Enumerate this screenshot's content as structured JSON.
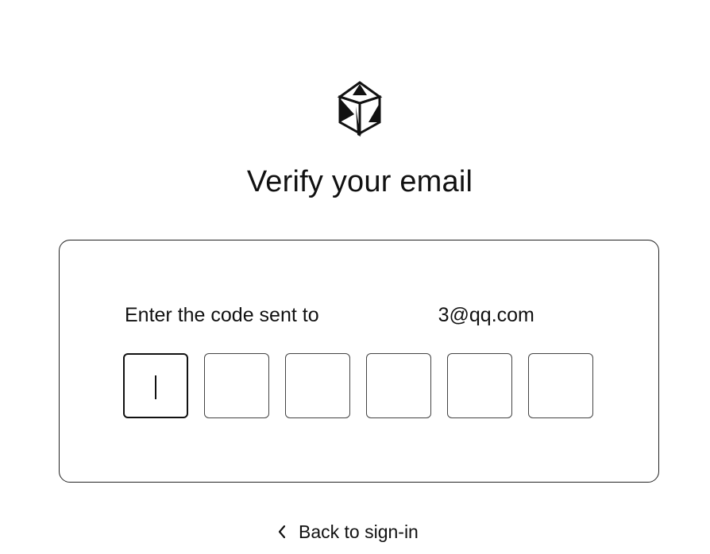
{
  "logo": {
    "icon": "cube-logo-icon"
  },
  "heading": "Verify your email",
  "card": {
    "prompt_prefix": "Enter the code sent to",
    "email_visible": "3@qq.com",
    "otp": {
      "length": 6,
      "active_index": 0,
      "values": [
        "",
        "",
        "",
        "",
        "",
        ""
      ]
    }
  },
  "back_link": {
    "label": "Back to sign-in",
    "icon": "chevron-left-icon"
  }
}
